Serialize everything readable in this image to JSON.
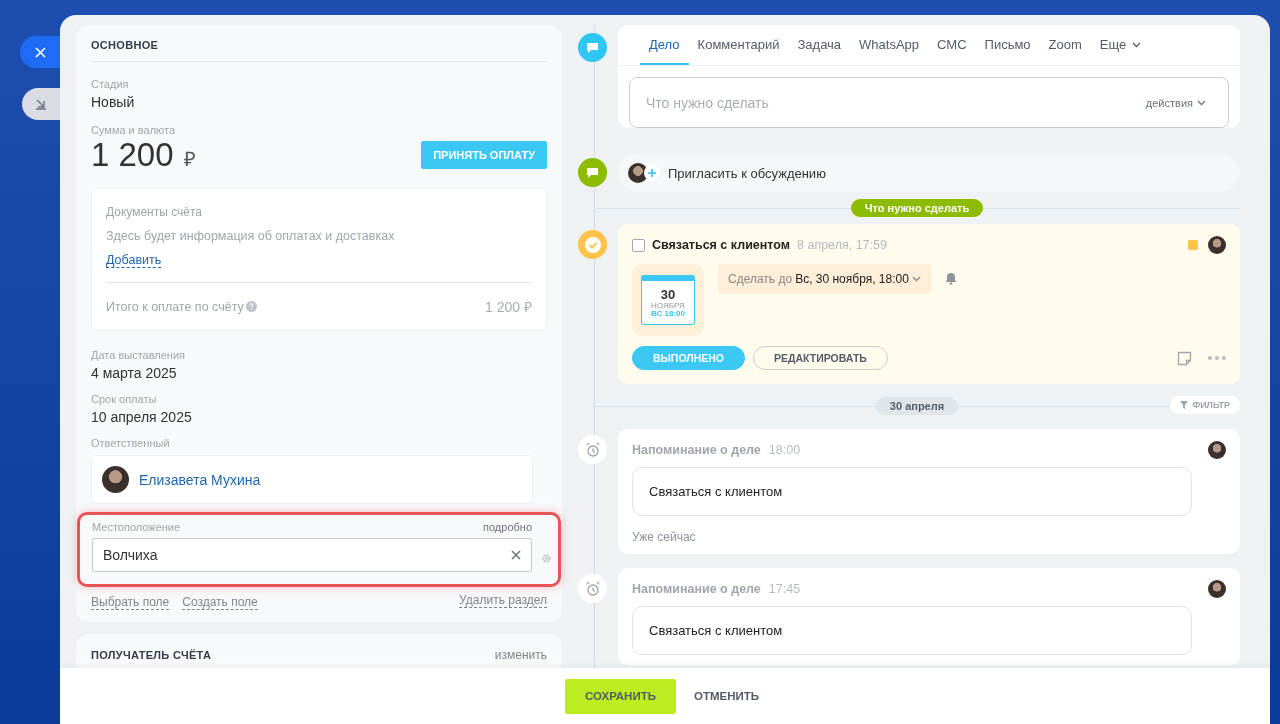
{
  "main_section": {
    "title": "ОСНОВНОЕ",
    "stage": {
      "label": "Стадия",
      "value": "Новый"
    },
    "amount": {
      "label": "Сумма и валюта",
      "value": "1 200",
      "currency": "₽",
      "button": "ПРИНЯТЬ ОПЛАТУ"
    },
    "documents": {
      "title": "Документы счёта",
      "info": "Здесь будет информация об оплатах и доставках",
      "link": "Добавить",
      "total_label": "Итого к оплате по счёту",
      "total_value": "1 200 ₽"
    },
    "issue_date": {
      "label": "Дата выставления",
      "value": "4 марта 2025"
    },
    "due_date": {
      "label": "Срок оплаты",
      "value": "10 апреля 2025"
    },
    "responsible": {
      "label": "Ответственный",
      "name": "Елизавета Мухина"
    },
    "location": {
      "label": "Местоположение",
      "details": "подробно",
      "value": "Волчиха",
      "highlighted": true
    },
    "links": [
      "Выбрать поле",
      "Создать поле"
    ],
    "delete_link": "Удалить раздел"
  },
  "recipient_section": {
    "title": "ПОЛУЧАТЕЛЬ СЧЁТА",
    "action": "изменить"
  },
  "tabs": [
    {
      "label": "Дело",
      "selected": true
    },
    {
      "label": "Комментарий",
      "selected": false
    },
    {
      "label": "Задача",
      "selected": false
    },
    {
      "label": "WhatsApp",
      "selected": false
    },
    {
      "label": "СМС",
      "selected": false
    },
    {
      "label": "Письмо",
      "selected": false
    },
    {
      "label": "Zoom",
      "selected": false
    },
    {
      "label": "Еще",
      "selected": false
    }
  ],
  "todo_input": {
    "placeholder": "Что нужно сделать",
    "actions": "действия"
  },
  "invite": "Пригласить к обсуждению",
  "todo_badge": "Что нужно сделать",
  "activity": {
    "checked": false,
    "title": "Связаться с клиентом",
    "time": "8 апреля, 17:59",
    "calendar_day": "30",
    "calendar_month": "НОЯБРЯ",
    "calendar_time": "ВС 18:00",
    "deadline_label": "Сделать до",
    "deadline_value": "Вс, 30 ноября, 18:00",
    "done_button": "ВЫПОЛНЕНО",
    "edit_button": "РЕДАКТИРОВАТЬ",
    "color": "#ffc34d"
  },
  "date_badge": "30 апреля",
  "filter": "ФИЛЬТР",
  "reminders": [
    {
      "title": "Напоминание о деле",
      "time": "18:00",
      "text": "Связаться с клиентом",
      "note": "Уже сейчас"
    },
    {
      "title": "Напоминание о деле",
      "time": "17:45",
      "text": "Связаться с клиентом"
    }
  ],
  "footer": {
    "save": "СОХРАНИТЬ",
    "cancel": "ОТМЕНИТЬ"
  }
}
